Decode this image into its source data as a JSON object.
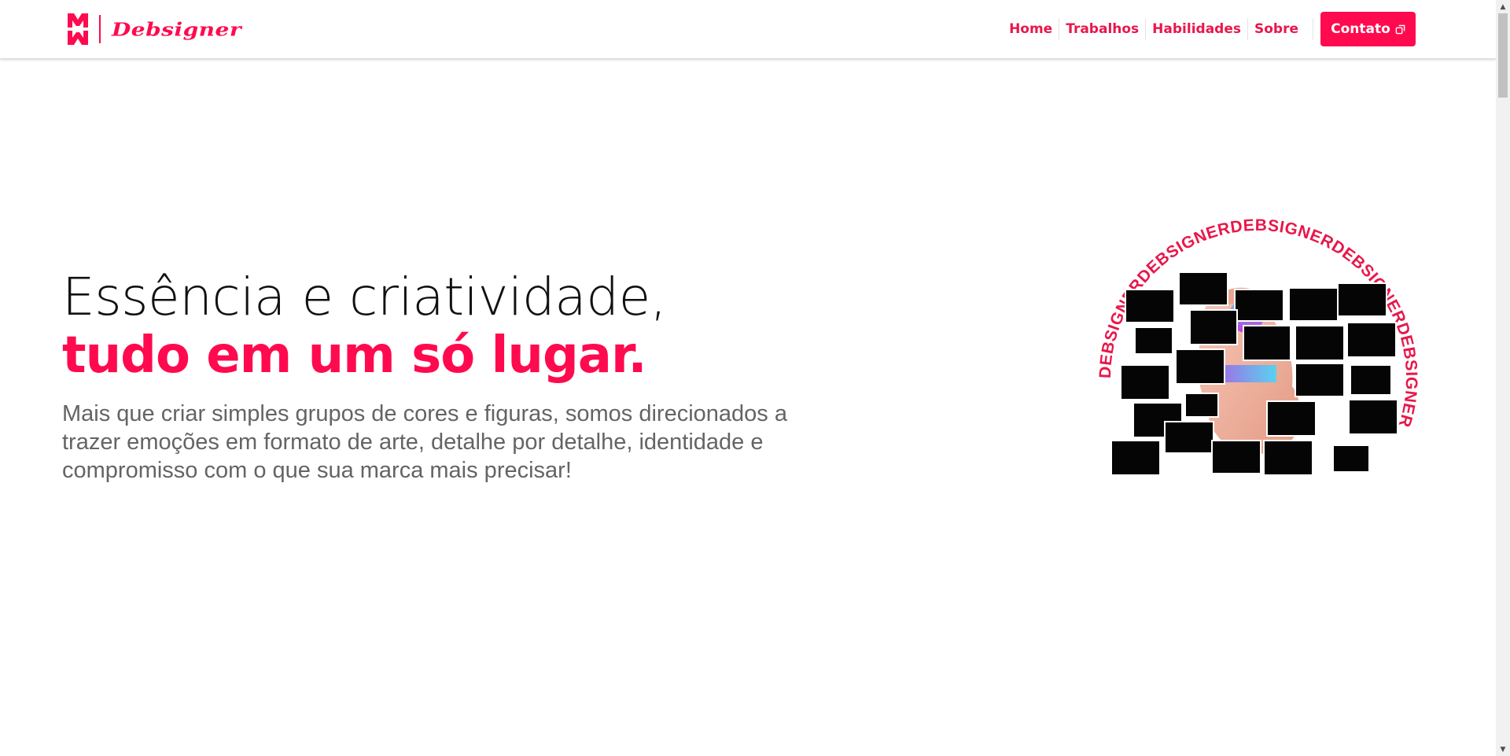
{
  "brand": {
    "name": "Debsigner",
    "accent_color": "#ff0a4e"
  },
  "nav": {
    "items": [
      {
        "label": "Home"
      },
      {
        "label": "Trabalhos"
      },
      {
        "label": "Habilidades"
      },
      {
        "label": "Sobre"
      }
    ],
    "contact_label": "Contato",
    "contact_icon": "external-link-icon"
  },
  "hero": {
    "title_line1": "Essência e criatividade,",
    "title_line2": "tudo em um só lugar.",
    "subtitle_lines": [
      "Mais que criar simples grupos de cores e figuras, somos direcionados a",
      "trazer emoções em formato de arte, detalhe por detalhe, identidade e",
      "compromisso com o que sua marca mais precisar!"
    ]
  },
  "illustration": {
    "ring_text": "DEBSIGNERDEBSIGNERDEBSIGNERDEBSIGNERDEBSIGNER",
    "ring_color": "#e8174b"
  },
  "scrollbar": {
    "up_icon": "scroll-up-arrow-icon",
    "down_icon": "scroll-down-arrow-icon"
  }
}
